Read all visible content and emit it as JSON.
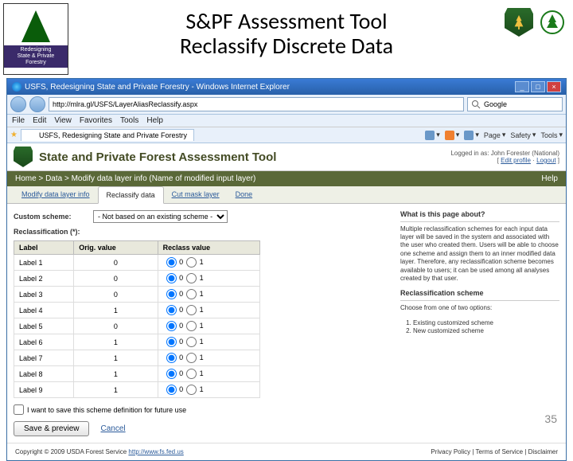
{
  "slide": {
    "title_line1": "S&PF Assessment Tool",
    "title_line2": "Reclassify Discrete Data",
    "page_number": "35",
    "logo_text_1": "Redesigning",
    "logo_text_2": "State & Private Forestry"
  },
  "ie": {
    "window_title": "USFS, Redesigning State and Private Forestry - Windows Internet Explorer",
    "url": "http://mlra.gl/USFS/LayerAliasReclassify.aspx",
    "search_placeholder": "Google",
    "menu": [
      "File",
      "Edit",
      "View",
      "Favorites",
      "Tools",
      "Help"
    ],
    "tab_label": "USFS, Redesigning State and Private Forestry",
    "tools": [
      "Home",
      "Feeds",
      "Print",
      "Page",
      "Safety",
      "Tools"
    ]
  },
  "app": {
    "title": "State and Private Forest Assessment Tool",
    "login_text": "Logged in as: John Forester (National)",
    "profile_link": "Edit profile",
    "logout_link": "Logout",
    "breadcrumb": "Home > Data > Modify data layer info (Name of modified input layer)",
    "help": "Help",
    "tabs": [
      {
        "label": "Modify data layer info",
        "active": false
      },
      {
        "label": "Reclassify data",
        "active": true
      },
      {
        "label": "Cut mask layer",
        "active": false
      },
      {
        "label": "Done",
        "active": false
      }
    ]
  },
  "form": {
    "scheme_label": "Custom scheme:",
    "scheme_value": "- Not based on an existing scheme -",
    "reclass_label": "Reclassification (*):",
    "headers": [
      "Label",
      "Orig. value",
      "Reclass value"
    ],
    "rows": [
      {
        "label": "Label 1",
        "orig": "0",
        "r0": true
      },
      {
        "label": "Label 2",
        "orig": "0",
        "r0": true
      },
      {
        "label": "Label 3",
        "orig": "0",
        "r0": true
      },
      {
        "label": "Label 4",
        "orig": "1",
        "r0": true
      },
      {
        "label": "Label 5",
        "orig": "0",
        "r0": true
      },
      {
        "label": "Label 6",
        "orig": "1",
        "r0": true
      },
      {
        "label": "Label 7",
        "orig": "1",
        "r0": true
      },
      {
        "label": "Label 8",
        "orig": "1",
        "r0": true
      },
      {
        "label": "Label 9",
        "orig": "1",
        "r0": true
      }
    ],
    "save_checkbox": "I want to save this scheme definition for future use",
    "save_btn": "Save & preview",
    "cancel": "Cancel"
  },
  "sidebar": {
    "about_h": "What is this page about?",
    "about_p": "Multiple reclassification schemes for each input data layer will be saved in the system and associated with the user who created them. Users will be able to choose one scheme and assign them to an inner modified data layer. Therefore, any reclassification scheme becomes available to users; it can be used among all analyses created by that user.",
    "scheme_h": "Reclassification scheme",
    "scheme_p": "Choose from one of two options:",
    "scheme_items": [
      "Existing customized scheme",
      "New customized scheme"
    ]
  },
  "footer": {
    "copyright": "Copyright © 2009 USDA Forest Service",
    "fs_link": "http://www.fs.fed.us",
    "links": "Privacy Policy | Terms of Service | Disclaimer"
  }
}
